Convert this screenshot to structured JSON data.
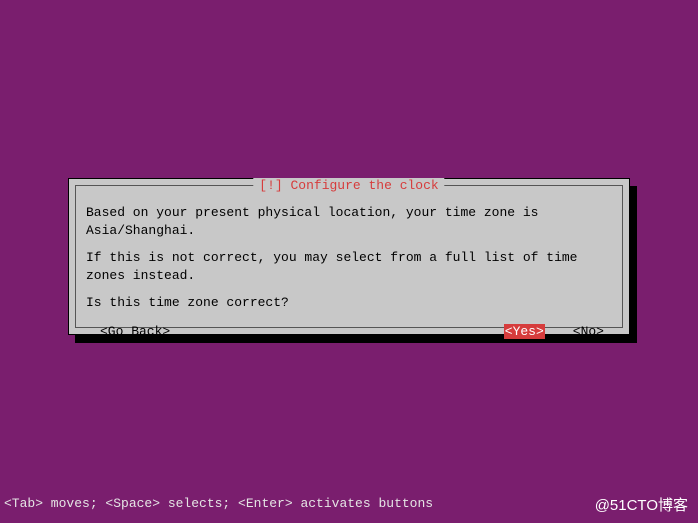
{
  "dialog": {
    "title": "[!] Configure the clock",
    "line1": "Based on your present physical location, your time zone is Asia/Shanghai.",
    "line2": "If this is not correct, you may select from a full list of time zones instead.",
    "prompt": "Is this time zone correct?",
    "buttons": {
      "go_back": "<Go Back>",
      "yes": "<Yes>",
      "no": "<No>"
    }
  },
  "help_bar": "<Tab> moves; <Space> selects; <Enter> activates buttons",
  "watermark": "@51CTO博客"
}
